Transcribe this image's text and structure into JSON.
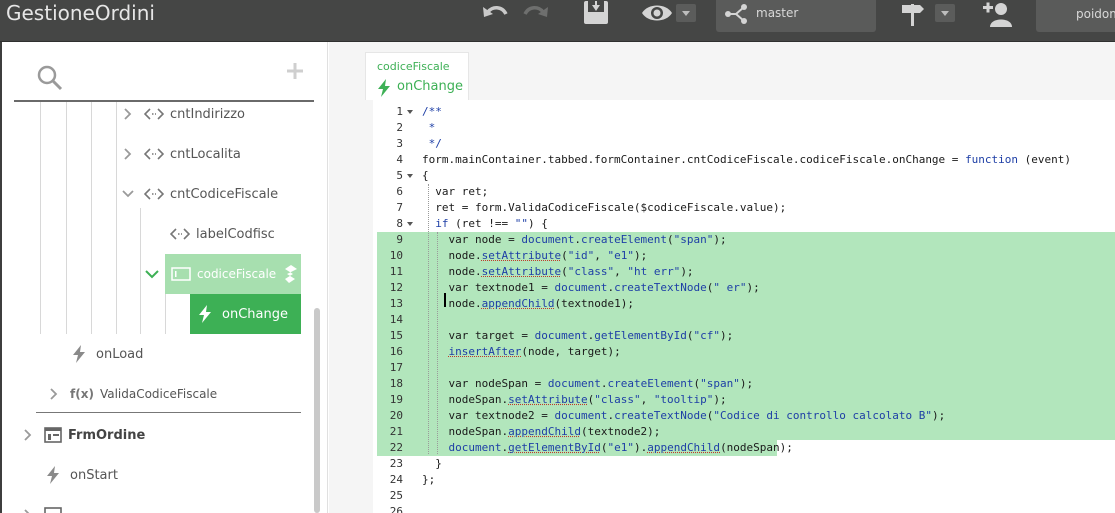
{
  "app": {
    "title": "GestioneOrdini"
  },
  "topbar": {
    "branch": "master",
    "user": "poidom"
  },
  "tree": {
    "items": [
      {
        "label": "cntIndirizzo"
      },
      {
        "label": "cntLocalita"
      },
      {
        "label": "cntCodiceFiscale"
      },
      {
        "label": "labelCodfisc"
      },
      {
        "label": "codiceFiscale"
      },
      {
        "label": "onChange"
      },
      {
        "label": "onLoad"
      },
      {
        "label": "ValidaCodiceFiscale",
        "prefix": "f(x)"
      },
      {
        "label": "FrmOrdine"
      },
      {
        "label": "onStart"
      }
    ]
  },
  "editor": {
    "tab": {
      "path": "codiceFiscale",
      "name": "onChange"
    },
    "fold_lines": [
      1,
      5,
      8
    ],
    "highlight_lines": [
      9,
      22
    ],
    "lines": [
      [
        [
          "/**",
          "com"
        ]
      ],
      [
        [
          " *",
          "com"
        ]
      ],
      [
        [
          " */",
          "com"
        ]
      ],
      [
        [
          "form.mainContainer.tabbed.formContainer.cntCodiceFiscale.codiceFiscale.onChange = ",
          ""
        ],
        [
          "function",
          "kw"
        ],
        [
          " (event)",
          ""
        ]
      ],
      [
        [
          "{",
          ""
        ]
      ],
      [
        [
          "  var ret;",
          ""
        ]
      ],
      [
        [
          "  ret = form.ValidaCodiceFiscale($codiceFiscale.value);",
          ""
        ]
      ],
      [
        [
          "  ",
          ""
        ],
        [
          "if",
          "kw"
        ],
        [
          " (ret !== ",
          ""
        ],
        [
          "\"\"",
          "str"
        ],
        [
          ") {",
          ""
        ]
      ],
      [
        [
          "    var node = ",
          ""
        ],
        [
          "document",
          "call"
        ],
        [
          ".",
          ""
        ],
        [
          "createElement",
          "call"
        ],
        [
          "(",
          ""
        ],
        [
          "\"span\"",
          "str"
        ],
        [
          ");",
          ""
        ]
      ],
      [
        [
          "    node.",
          ""
        ],
        [
          "setAttribute",
          "ul"
        ],
        [
          "(",
          ""
        ],
        [
          "\"id\"",
          "str"
        ],
        [
          ", ",
          ""
        ],
        [
          "\"e1\"",
          "str"
        ],
        [
          ");",
          ""
        ]
      ],
      [
        [
          "    node.",
          ""
        ],
        [
          "setAttribute",
          "ul"
        ],
        [
          "(",
          ""
        ],
        [
          "\"class\"",
          "str"
        ],
        [
          ", ",
          ""
        ],
        [
          "\"ht err\"",
          "str"
        ],
        [
          ");",
          ""
        ]
      ],
      [
        [
          "    var textnode1 = ",
          ""
        ],
        [
          "document",
          "call"
        ],
        [
          ".",
          ""
        ],
        [
          "createTextNode",
          "call"
        ],
        [
          "(",
          ""
        ],
        [
          "\" er\"",
          "str"
        ],
        [
          ");",
          ""
        ]
      ],
      [
        [
          "    node.",
          ""
        ],
        [
          "appendChild",
          "ul"
        ],
        [
          "(textnode1);",
          ""
        ]
      ],
      [
        [
          "",
          ""
        ]
      ],
      [
        [
          "    var target = ",
          ""
        ],
        [
          "document",
          "call"
        ],
        [
          ".",
          ""
        ],
        [
          "getElementById",
          "call"
        ],
        [
          "(",
          ""
        ],
        [
          "\"cf\"",
          "str"
        ],
        [
          ");",
          ""
        ]
      ],
      [
        [
          "    ",
          ""
        ],
        [
          "insertAfter",
          "ul"
        ],
        [
          "(node, target);",
          ""
        ]
      ],
      [
        [
          "",
          ""
        ]
      ],
      [
        [
          "    var nodeSpan = ",
          ""
        ],
        [
          "document",
          "call"
        ],
        [
          ".",
          ""
        ],
        [
          "createElement",
          "call"
        ],
        [
          "(",
          ""
        ],
        [
          "\"span\"",
          "str"
        ],
        [
          ");",
          ""
        ]
      ],
      [
        [
          "    nodeSpan.",
          ""
        ],
        [
          "setAttribute",
          "ul"
        ],
        [
          "(",
          ""
        ],
        [
          "\"class\"",
          "str"
        ],
        [
          ", ",
          ""
        ],
        [
          "\"tooltip\"",
          "str"
        ],
        [
          ");",
          ""
        ]
      ],
      [
        [
          "    var textnode2 = ",
          ""
        ],
        [
          "document",
          "call"
        ],
        [
          ".",
          ""
        ],
        [
          "createTextNode",
          "call"
        ],
        [
          "(",
          ""
        ],
        [
          "\"Codice di controllo calcolato B\"",
          "str"
        ],
        [
          ");",
          ""
        ]
      ],
      [
        [
          "    nodeSpan.",
          ""
        ],
        [
          "appendChild",
          "ul"
        ],
        [
          "(textnode2);",
          ""
        ]
      ],
      [
        [
          "    ",
          ""
        ],
        [
          "document",
          "call"
        ],
        [
          ".",
          ""
        ],
        [
          "getElementById",
          "ul"
        ],
        [
          "(",
          ""
        ],
        [
          "\"e1\"",
          "str"
        ],
        [
          ").",
          ""
        ],
        [
          "appendChild",
          "ul"
        ],
        [
          "(nodeSpan);",
          ""
        ]
      ],
      [
        [
          "  }",
          ""
        ]
      ],
      [
        [
          "};",
          ""
        ]
      ],
      [
        [
          "",
          ""
        ]
      ],
      [
        [
          "",
          ""
        ]
      ]
    ]
  }
}
